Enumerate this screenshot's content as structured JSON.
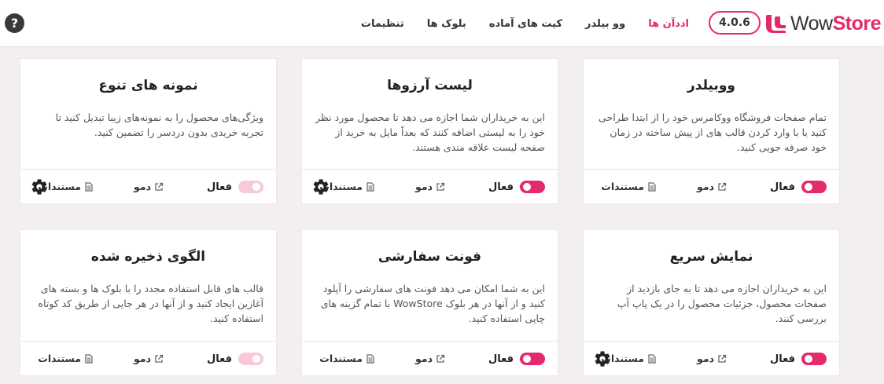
{
  "header": {
    "help_symbol": "?",
    "version": "4.0.6",
    "brand_wow": "Wow",
    "brand_store": "Store",
    "nav": [
      {
        "label": "اددآن ها",
        "active": true
      },
      {
        "label": "وو بیلدر",
        "active": false
      },
      {
        "label": "کیت های آماده",
        "active": false
      },
      {
        "label": "بلوک ها",
        "active": false
      },
      {
        "label": "تنظیمات",
        "active": false
      }
    ]
  },
  "labels": {
    "active": "فعال",
    "demo": "دمو",
    "docs": "مستندات"
  },
  "cards": [
    {
      "title": "ووبیلدر",
      "description": "تمام صفحات فروشگاه ووکامرس خود را از ابتدا طراحی کنید یا با وارد کردن قالب های از پیش ساخته در زمان خود صرفه جویی کنید.",
      "enabled": true,
      "has_settings": false
    },
    {
      "title": "لیست آرزوها",
      "description": "این به خریداران شما اجازه می دهد تا محصول مورد نظر خود را به لیستی اضافه کنند که بعداً مایل به خرید از صفحه لیست علاقه مندی هستند.",
      "enabled": true,
      "has_settings": true
    },
    {
      "title": "نمونه های تنوع",
      "description": "ویژگی‌های محصول را به نمونه‌های زیبا تبدیل کنید تا تجربه خریدی بدون دردسر را تضمین کنید.",
      "enabled": false,
      "has_settings": true
    },
    {
      "title": "نمایش سریع",
      "description": "این به خریداران اجازه می دهد تا به جای بازدید از صفحات محصول، جزئیات محصول را در یک پاپ آپ بررسی کنند.",
      "enabled": true,
      "has_settings": true
    },
    {
      "title": "فونت سفارشی",
      "description": "این به شما امکان می دهد فونت های سفارشی را آپلود کنید و از آنها در هر بلوک WowStore با تمام گزینه های چاپی استفاده کنید.",
      "enabled": true,
      "has_settings": false
    },
    {
      "title": "الگوی ذخیره شده",
      "description": "قالب های قابل استفاده مجدد را با بلوک ها و بسته های آغازین ایجاد کنید و از آنها در هر جایی از طریق کد کوتاه استفاده کنید.",
      "enabled": false,
      "has_settings": false
    }
  ],
  "colors": {
    "accent": "#e5296d",
    "toggle_off": "#f9c9da"
  },
  "icons": [
    "help-icon",
    "logo-icon",
    "external-link-icon",
    "document-icon",
    "gear-icon"
  ]
}
